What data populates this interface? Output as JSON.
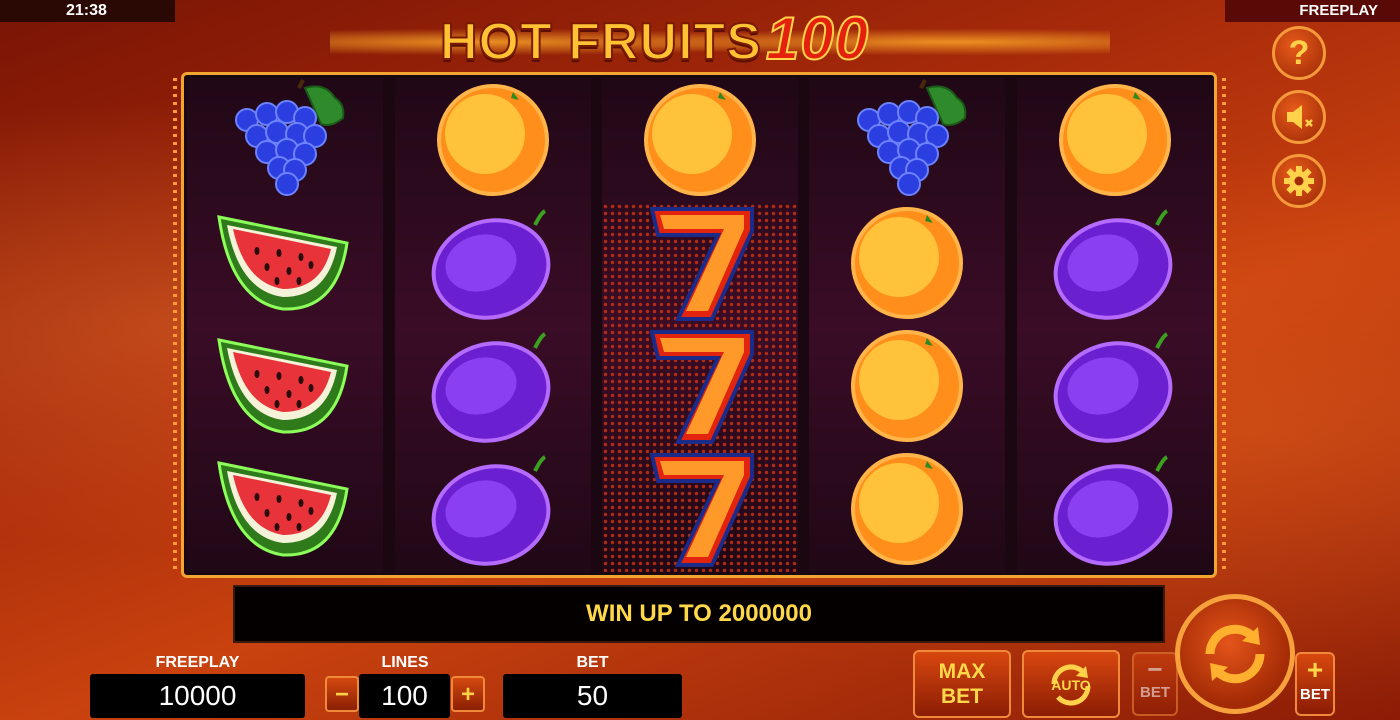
{
  "status_bar": {
    "time": "21:38",
    "mode": "FREEPLAY"
  },
  "logo": {
    "name": "HOT FRUITS",
    "number": "100"
  },
  "reels": [
    [
      "grapes",
      "watermelon",
      "watermelon",
      "watermelon"
    ],
    [
      "orange",
      "plum",
      "plum",
      "plum"
    ],
    [
      "orange",
      "seven",
      "seven",
      "seven"
    ],
    [
      "grapes",
      "orange",
      "orange",
      "orange"
    ],
    [
      "orange",
      "plum",
      "plum",
      "plum"
    ]
  ],
  "message": "WIN UP TO 2000000",
  "freeplay": {
    "label": "FREEPLAY",
    "value": "10000"
  },
  "lines": {
    "label": "LINES",
    "value": "100",
    "minus": "−",
    "plus": "+"
  },
  "bet": {
    "label": "BET",
    "value": "50"
  },
  "buttons": {
    "max_bet_line1": "MAX",
    "max_bet_line2": "BET",
    "auto": "AUTO",
    "bet_minus_sign": "−",
    "bet_minus_label": "BET",
    "bet_plus_sign": "+",
    "bet_plus_label": "BET",
    "help": "?"
  },
  "colors": {
    "accent": "#ffd84a",
    "frame": "#f3a531",
    "button": "#c63d0c"
  }
}
